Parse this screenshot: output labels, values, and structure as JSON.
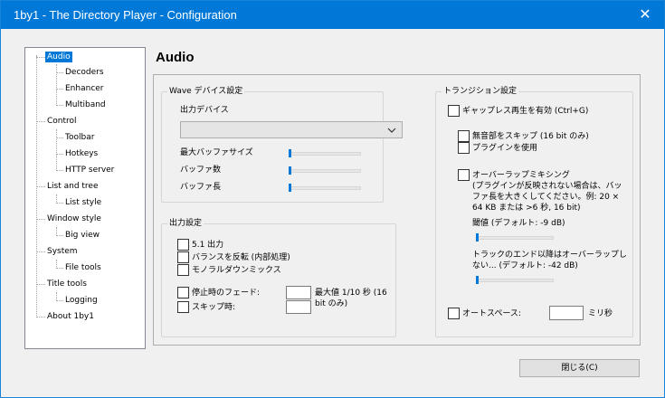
{
  "window": {
    "title": "1by1 - The Directory Player - Configuration",
    "close_glyph": "✕"
  },
  "tree": {
    "items": [
      {
        "label": "Audio",
        "level": 0
      },
      {
        "label": "Decoders",
        "level": 1
      },
      {
        "label": "Enhancer",
        "level": 1
      },
      {
        "label": "Multiband",
        "level": 1
      },
      {
        "label": "Control",
        "level": 0
      },
      {
        "label": "Toolbar",
        "level": 1
      },
      {
        "label": "Hotkeys",
        "level": 1
      },
      {
        "label": "HTTP server",
        "level": 1
      },
      {
        "label": "List and tree",
        "level": 0
      },
      {
        "label": "List style",
        "level": 1
      },
      {
        "label": "Window style",
        "level": 0
      },
      {
        "label": "Big view",
        "level": 1
      },
      {
        "label": "System",
        "level": 0
      },
      {
        "label": "File tools",
        "level": 1
      },
      {
        "label": "Title tools",
        "level": 0
      },
      {
        "label": "Logging",
        "level": 1
      },
      {
        "label": "About 1by1",
        "level": 0
      }
    ],
    "selected": "Audio"
  },
  "page": {
    "heading": "Audio"
  },
  "wave": {
    "group_label": "Wave デバイス設定",
    "device_label": "出力デバイス",
    "device_value": "",
    "buffer_size_label": "最大バッファサイズ",
    "buffer_count_label": "バッファ数",
    "buffer_length_label": "バッファ長",
    "buffer_size_level": 0,
    "buffer_count_level": 0,
    "buffer_length_level": 0
  },
  "output": {
    "group_label": "出力設定",
    "ch51_label": "5.1 出力",
    "reverse_label": "バランスを反転 (内部処理)",
    "mono_label": "モノラルダウンミックス",
    "fade_stop_label": "停止時のフェード:",
    "skip_label": "スキップ時:",
    "fade_stop_value": "",
    "skip_value": "",
    "max_note": "最大値 1/10 秒 (16 bit のみ)"
  },
  "transition": {
    "group_label": "トランジション設定",
    "gapless_label": "ギャップレス再生を有効 (Ctrl+G)",
    "skip_silence_label": "無音部をスキップ (16 bit のみ)",
    "use_plugin_label": "プラグインを使用",
    "overlap_label": "オーバーラップミキシング",
    "overlap_note": "(プラグインが反映されない場合は、バッファ長を大きくしてください。例: 20 × 64 KB または >6 秒, 16 bit)",
    "threshold_label": "閾値 (デフォルト: -9 dB)",
    "threshold_level": 0,
    "track_end_label": "トラックのエンド以降はオーバーラップしない... (デフォルト: -42 dB)",
    "track_end_level": 0
  },
  "autospace": {
    "label": "オートスペース:",
    "value": "",
    "unit": "ミリ秒"
  },
  "footer": {
    "close_button": "閉じる(C)"
  }
}
